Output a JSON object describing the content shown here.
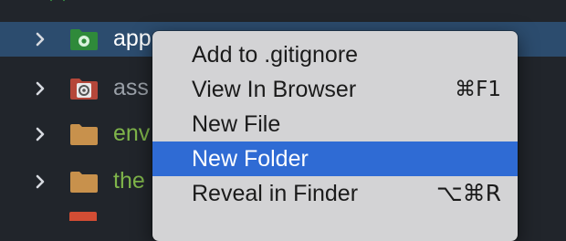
{
  "tree": {
    "items": [
      {
        "label": "app",
        "icon": "green-settings-folder-icon",
        "selected": true,
        "color": "#ffffff"
      },
      {
        "label": "ass",
        "icon": "red-settings-folder-icon",
        "selected": false,
        "color": "#9aa0a8"
      },
      {
        "label": "env",
        "icon": "folder-icon",
        "selected": false,
        "color": "#7fb54a"
      },
      {
        "label": "the",
        "icon": "folder-icon",
        "selected": false,
        "color": "#7fb54a"
      }
    ]
  },
  "context_menu": {
    "items": [
      {
        "label": "Add to .gitignore",
        "shortcut": ""
      },
      {
        "label": "View In Browser",
        "shortcut": "⌘F1"
      },
      {
        "label": "New File",
        "shortcut": ""
      },
      {
        "label": "New Folder",
        "shortcut": "",
        "highlighted": true
      },
      {
        "label": "Reveal in Finder",
        "shortcut": "⌥⌘R"
      }
    ]
  },
  "colors": {
    "background": "#21252b",
    "selection": "#2c4c6e",
    "menu_background": "#d3d3d5",
    "menu_highlight": "#2f6bd4"
  }
}
